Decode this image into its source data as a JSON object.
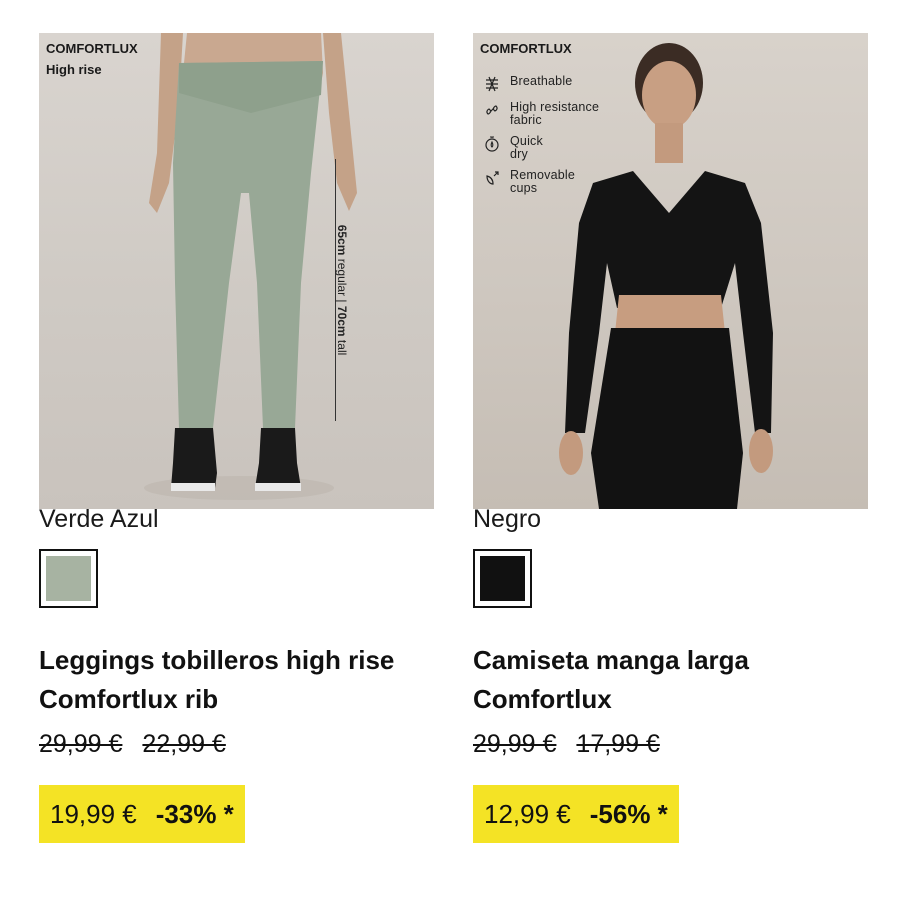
{
  "products": [
    {
      "badge": "COMFORTLUX",
      "badge_sub": "High rise",
      "measure_bold_1": "65cm",
      "measure_text_1": " regular | ",
      "measure_bold_2": "70cm",
      "measure_text_2": " tall",
      "color_name": "Verde Azul",
      "swatch_color": "#a7b3a2",
      "title_line1": "Leggings tobilleros high rise",
      "title_line2": "Comfortlux rib",
      "old_price_1": "29,99 €",
      "old_price_2": "22,99 €",
      "price": "19,99 €",
      "discount": "-33% *"
    },
    {
      "badge": "COMFORTLUX",
      "features": [
        {
          "icon": "breathable-icon",
          "text": "Breathable"
        },
        {
          "icon": "resistance-icon",
          "text": "High resistance fabric"
        },
        {
          "icon": "quick-dry-icon",
          "text": "Quick dry"
        },
        {
          "icon": "removable-cups-icon",
          "text": "Removable cups"
        }
      ],
      "color_name": "Negro",
      "swatch_color": "#111111",
      "title_line1": "Camiseta manga larga",
      "title_line2": "Comfortlux",
      "old_price_1": "29,99 €",
      "old_price_2": "17,99 €",
      "price": "12,99 €",
      "discount": "-56% *"
    }
  ],
  "colors": {
    "promo_bg": "#f4e325",
    "text": "#111111"
  }
}
